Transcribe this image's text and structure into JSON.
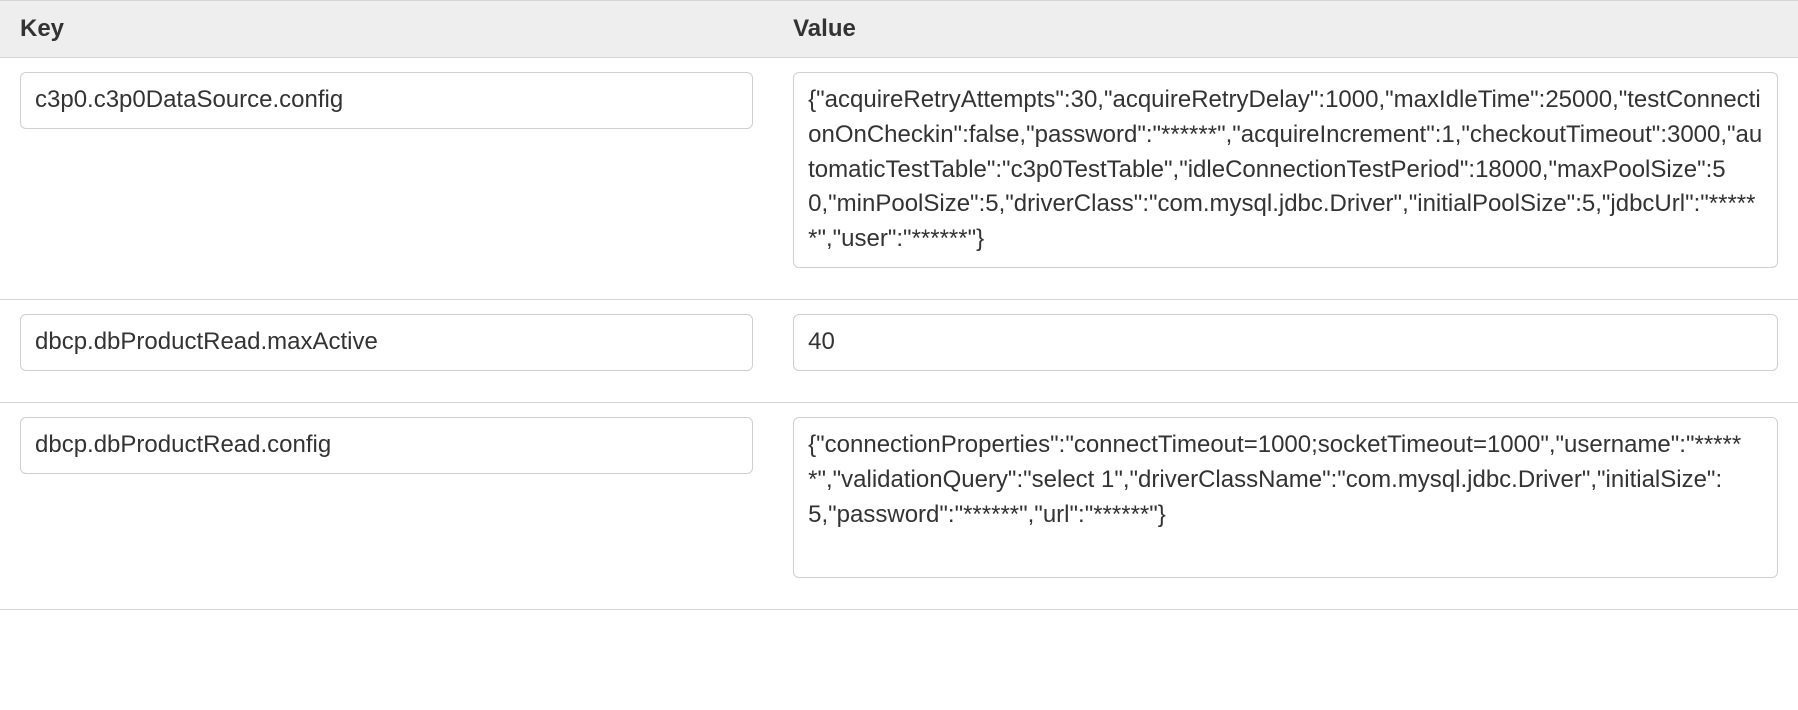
{
  "table": {
    "headers": {
      "key": "Key",
      "value": "Value"
    },
    "rows": [
      {
        "key": "c3p0.c3p0DataSource.config",
        "value": "{\"acquireRetryAttempts\":30,\"acquireRetryDelay\":1000,\"maxIdleTime\":25000,\"testConnectionOnCheckin\":false,\"password\":\"******\",\"acquireIncrement\":1,\"checkoutTimeout\":3000,\"automaticTestTable\":\"c3p0TestTable\",\"idleConnectionTestPeriod\":18000,\"maxPoolSize\":50,\"minPoolSize\":5,\"driverClass\":\"com.mysql.jdbc.Driver\",\"initialPoolSize\":5,\"jdbcUrl\":\"******\",\"user\":\"******\"}"
      },
      {
        "key": "dbcp.dbProductRead.maxActive",
        "value": "40"
      },
      {
        "key": "dbcp.dbProductRead.config",
        "value": "{\"connectionProperties\":\"connectTimeout=1000;socketTimeout=1000\",\"username\":\"******\",\"validationQuery\":\"select 1\",\"driverClassName\":\"com.mysql.jdbc.Driver\",\"initialSize\":5,\"password\":\"******\",\"url\":\"******\"}"
      }
    ]
  }
}
